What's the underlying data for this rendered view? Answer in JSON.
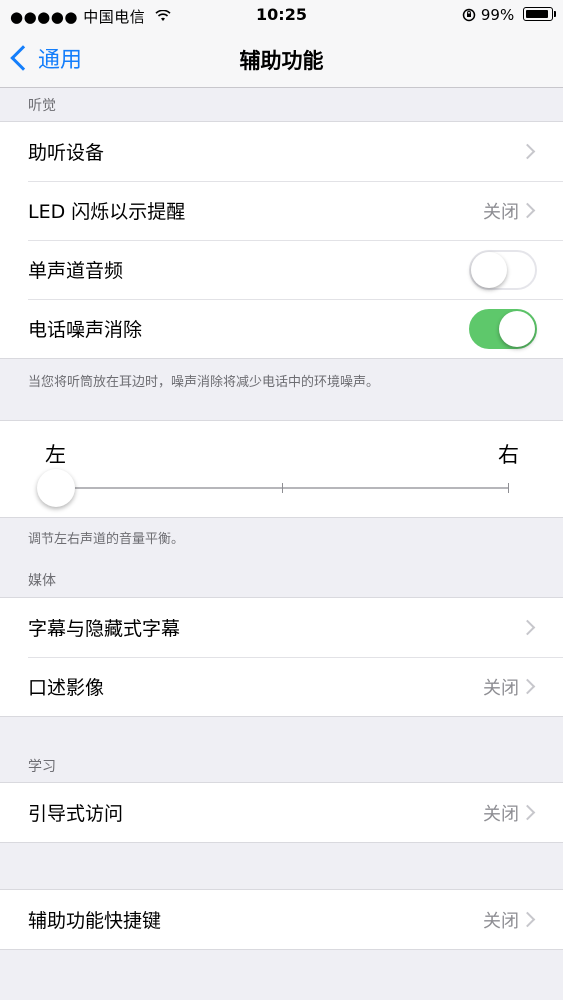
{
  "status_bar": {
    "carrier": "●●●●● 中国电信",
    "wifi_icon": "wifi-icon",
    "time": "10:25",
    "battery_text": "99%",
    "orientation_lock_icon": "orientation-lock-icon"
  },
  "nav": {
    "back_label": "通用",
    "title": "辅助功能"
  },
  "hearing": {
    "header": "听觉",
    "rows": [
      {
        "label": "助听设备",
        "value": ""
      },
      {
        "label": "LED 闪烁以示提醒",
        "value": "关闭"
      },
      {
        "label": "单声道音频",
        "toggle": "off"
      },
      {
        "label": "电话噪声消除",
        "toggle": "on"
      }
    ],
    "footer": "当您将听筒放在耳边时，噪声消除将减少电话中的环境噪声。"
  },
  "balance": {
    "left_label": "左",
    "right_label": "右",
    "position": 0,
    "footer": "调节左右声道的音量平衡。"
  },
  "media": {
    "header": "媒体",
    "rows": [
      {
        "label": "字幕与隐藏式字幕",
        "value": ""
      },
      {
        "label": "口述影像",
        "value": "关闭"
      }
    ]
  },
  "learning": {
    "header": "学习",
    "rows": [
      {
        "label": "引导式访问",
        "value": "关闭"
      }
    ]
  },
  "shortcut": {
    "rows": [
      {
        "label": "辅助功能快捷键",
        "value": "关闭"
      }
    ]
  },
  "colors": {
    "accent": "#147efb",
    "toggle_on": "#5ec86b",
    "background": "#efeff4"
  }
}
